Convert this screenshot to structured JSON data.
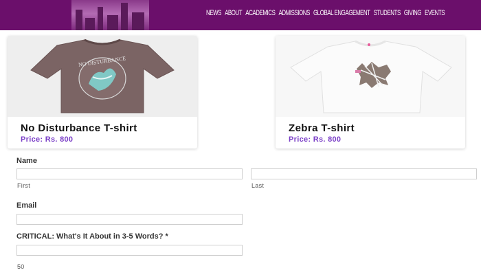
{
  "header": {
    "nav": [
      "NEWS",
      "ABOUT",
      "ACADEMICS",
      "ADMISSIONS",
      "GLOBAL ENGAGEMENT",
      "STUDENTS",
      "GIVING",
      "EVENTS"
    ],
    "background": "#6b0f6b"
  },
  "products": [
    {
      "title": "No Disturbance T-shirt",
      "price": "Price: Rs. 800",
      "shirt_print": "NO DISTURBANCE"
    },
    {
      "title": "Zebra T-shirt",
      "price": "Price: Rs. 800"
    }
  ],
  "form": {
    "name_label": "Name",
    "first_sub": "First",
    "last_sub": "Last",
    "email_label": "Email",
    "critical_label": "CRITICAL: What's It About in 3-5 Words? *",
    "char_count": "50"
  },
  "colors": {
    "price": "#7a3ec7",
    "brand": "#6b0f6b"
  }
}
